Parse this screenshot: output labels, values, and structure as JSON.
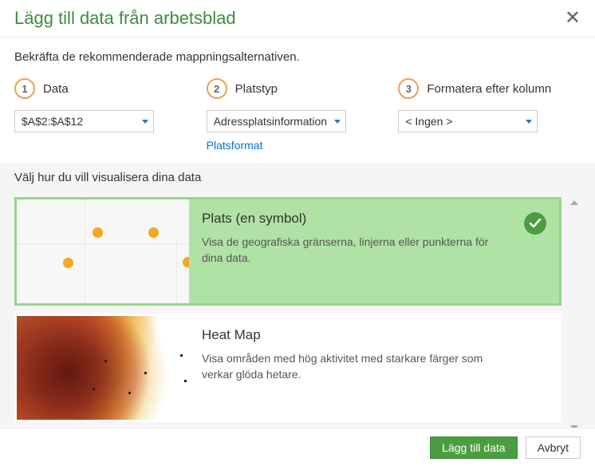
{
  "dialog": {
    "title": "Lägg till data från arbetsblad",
    "subtitle": "Bekräfta de rekommenderade mappningsalternativen."
  },
  "steps": {
    "s1": {
      "num": "1",
      "label": "Data",
      "value": "$A$2:$A$12"
    },
    "s2": {
      "num": "2",
      "label": "Platstyp",
      "value": "Adressplatsinformation",
      "link": "Platsformat"
    },
    "s3": {
      "num": "3",
      "label": "Formatera efter kolumn",
      "value": "< Ingen >"
    }
  },
  "viz": {
    "section_label": "Välj hur du vill visualisera dina data",
    "options": [
      {
        "title": "Plats (en symbol)",
        "desc": "Visa de geografiska gränserna, linjerna eller punkterna för dina data.",
        "selected": true
      },
      {
        "title": "Heat Map",
        "desc": "Visa områden med hög aktivitet med starkare färger som verkar glöda hetare.",
        "selected": false
      }
    ]
  },
  "footer": {
    "primary": "Lägg till data",
    "cancel": "Avbryt"
  }
}
